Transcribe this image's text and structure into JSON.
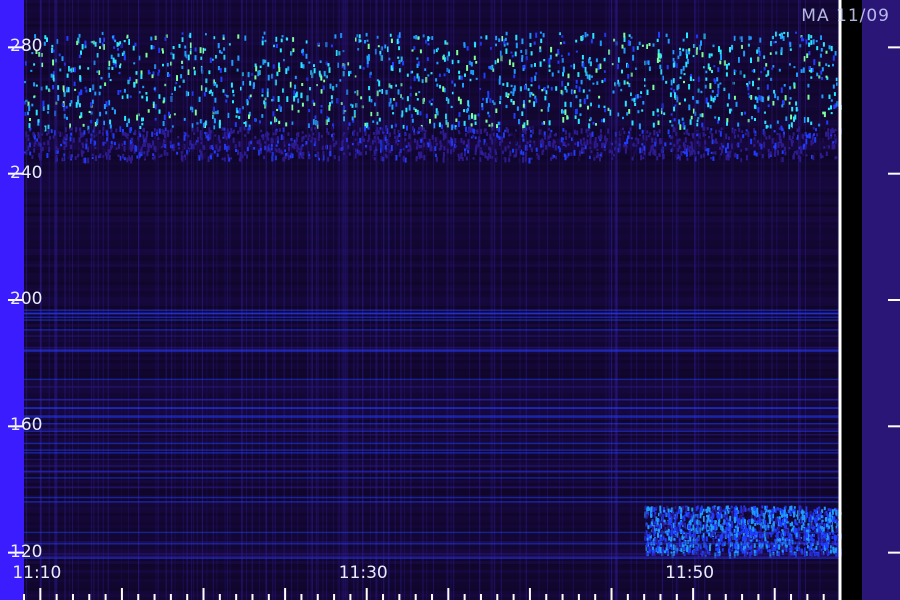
{
  "stamp": "MA 11/09",
  "chart_data": {
    "type": "heatmap",
    "y_ticks": [
      120,
      160,
      200,
      240,
      280
    ],
    "ylim": [
      105,
      295
    ],
    "x_ticks": [
      "11:10",
      "11:30",
      "11:50"
    ],
    "x_tick_minutes": [
      670,
      690,
      710
    ],
    "xlim_minutes": [
      669,
      719
    ],
    "colormap": [
      "#000000",
      "#1b0a4a",
      "#2d1a8f",
      "#1f3cff",
      "#1e9cff",
      "#28e8ff",
      "#7dff9a",
      "#e8ff33"
    ],
    "bands": [
      {
        "y_from": 255,
        "y_to": 285,
        "intensity": 0.75
      },
      {
        "y_from": 245,
        "y_to": 255,
        "intensity": 0.35
      },
      {
        "y_from": 120,
        "y_to": 135,
        "intensity": 0.55,
        "x_from_minutes": 707
      }
    ]
  }
}
